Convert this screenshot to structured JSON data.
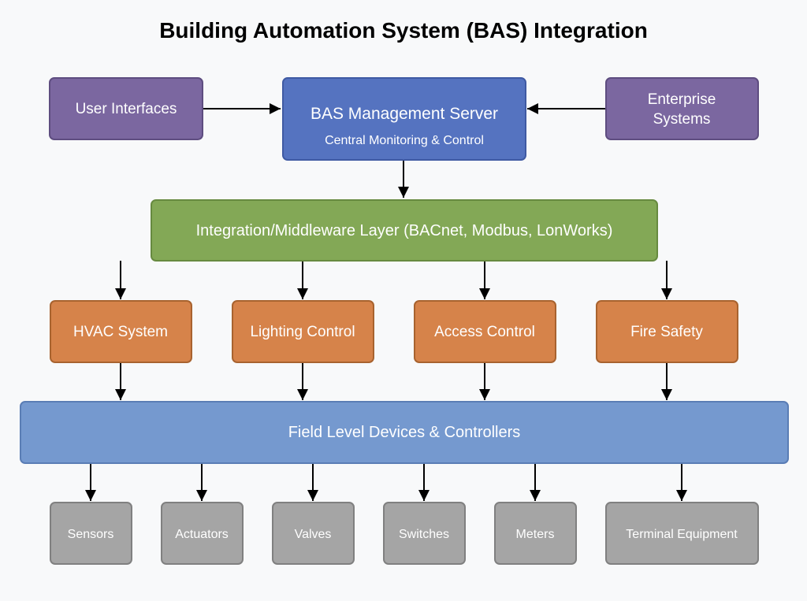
{
  "title": "Building Automation System (BAS) Integration",
  "colors": {
    "background": "#f8f9fa",
    "interface": "#7b67a0",
    "interface_border": "#5e4d80",
    "server": "#5573c0",
    "server_border": "#3f5aa3",
    "middleware": "#83a856",
    "middleware_border": "#678a40",
    "subsystem": "#d6834a",
    "subsystem_border": "#a8632f",
    "field": "#7599cf",
    "field_border": "#5a7db5",
    "device": "#a5a5a5",
    "device_border": "#808080",
    "edge": "#000000"
  },
  "nodes": {
    "user_interfaces": {
      "label": "User Interfaces"
    },
    "server": {
      "label": "BAS Management Server",
      "sublabel": "Central Monitoring & Control"
    },
    "enterprise": {
      "label_lines": [
        "Enterprise",
        "Systems"
      ]
    },
    "middleware": {
      "label": "Integration/Middleware Layer (BACnet, Modbus, LonWorks)"
    },
    "subsystems": [
      {
        "label": "HVAC System"
      },
      {
        "label": "Lighting Control"
      },
      {
        "label": "Access Control"
      },
      {
        "label": "Fire Safety"
      }
    ],
    "field": {
      "label": "Field Level Devices & Controllers"
    },
    "devices": [
      {
        "label": "Sensors"
      },
      {
        "label": "Actuators"
      },
      {
        "label": "Valves"
      },
      {
        "label": "Switches"
      },
      {
        "label": "Meters"
      },
      {
        "label": "Terminal Equipment"
      }
    ]
  },
  "edges": [
    {
      "from": "User Interfaces",
      "to": "BAS Management Server"
    },
    {
      "from": "Enterprise Systems",
      "to": "BAS Management Server"
    },
    {
      "from": "BAS Management Server",
      "to": "Integration/Middleware Layer"
    },
    {
      "from": "Integration/Middleware Layer",
      "to": "HVAC System"
    },
    {
      "from": "Integration/Middleware Layer",
      "to": "Lighting Control"
    },
    {
      "from": "Integration/Middleware Layer",
      "to": "Access Control"
    },
    {
      "from": "Integration/Middleware Layer",
      "to": "Fire Safety"
    },
    {
      "from": "HVAC System",
      "to": "Field Level Devices & Controllers"
    },
    {
      "from": "Lighting Control",
      "to": "Field Level Devices & Controllers"
    },
    {
      "from": "Access Control",
      "to": "Field Level Devices & Controllers"
    },
    {
      "from": "Fire Safety",
      "to": "Field Level Devices & Controllers"
    },
    {
      "from": "Field Level Devices & Controllers",
      "to": "Sensors"
    },
    {
      "from": "Field Level Devices & Controllers",
      "to": "Actuators"
    },
    {
      "from": "Field Level Devices & Controllers",
      "to": "Valves"
    },
    {
      "from": "Field Level Devices & Controllers",
      "to": "Switches"
    },
    {
      "from": "Field Level Devices & Controllers",
      "to": "Meters"
    },
    {
      "from": "Field Level Devices & Controllers",
      "to": "Terminal Equipment"
    }
  ]
}
